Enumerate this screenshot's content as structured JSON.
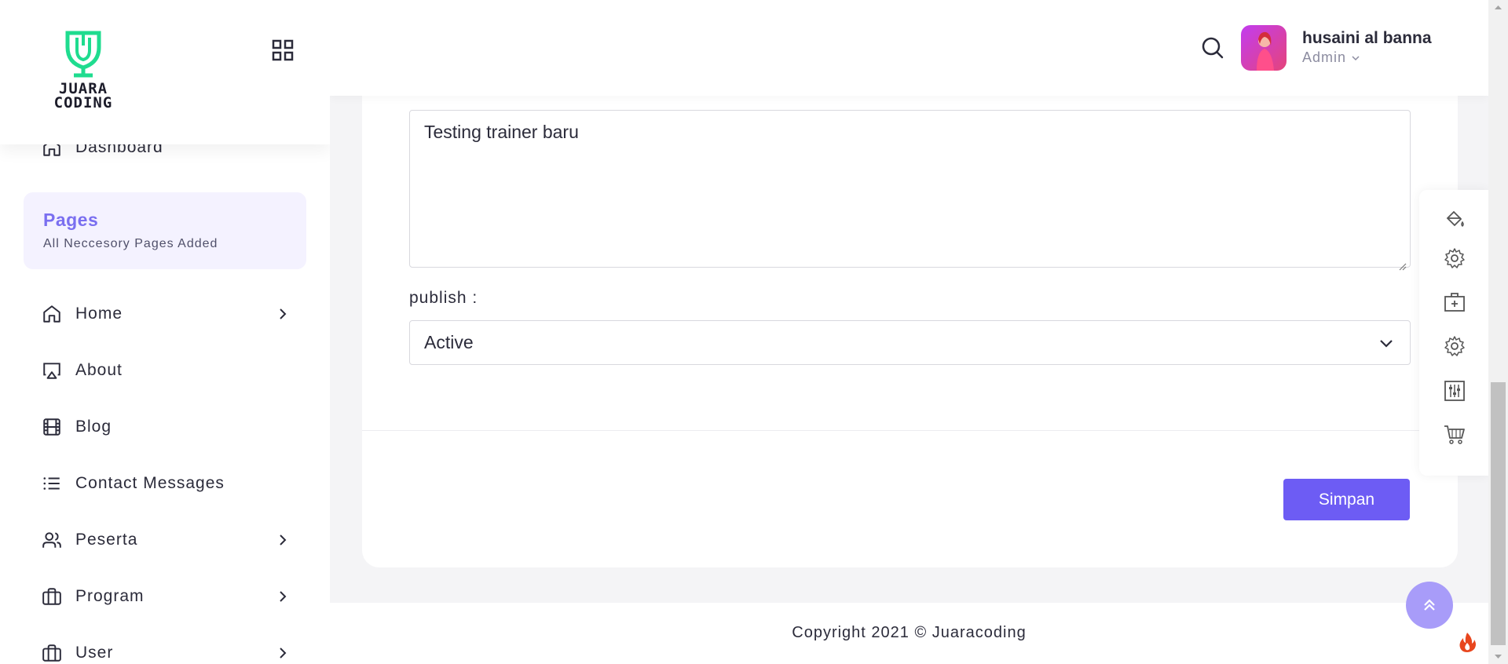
{
  "brand": {
    "logo_text_line1": "JUARA",
    "logo_text_line2": "CODING",
    "accent": "#1fdc8f"
  },
  "sidebar": {
    "dashboard": {
      "label": "Dashboard",
      "icon": "home-icon"
    },
    "pages_section": {
      "title": "Pages",
      "subtitle": "All Neccesory Pages Added"
    },
    "items": [
      {
        "label": "Home",
        "icon": "home-icon",
        "has_submenu": true
      },
      {
        "label": "About",
        "icon": "airplay-icon",
        "has_submenu": false
      },
      {
        "label": "Blog",
        "icon": "film-icon",
        "has_submenu": false
      },
      {
        "label": "Contact Messages",
        "icon": "list-icon",
        "has_submenu": false
      },
      {
        "label": "Peserta",
        "icon": "users-icon",
        "has_submenu": true
      },
      {
        "label": "Program",
        "icon": "briefcase-icon",
        "has_submenu": true
      },
      {
        "label": "User",
        "icon": "briefcase-icon",
        "has_submenu": true
      }
    ]
  },
  "header": {
    "user_name": "husaini al banna",
    "user_role": "Admin"
  },
  "form": {
    "description_value": "Testing trainer baru",
    "publish_label": "publish :",
    "publish_selected": "Active",
    "submit_label": "Simpan"
  },
  "tools": [
    "paint-bucket-icon",
    "gear-icon",
    "medical-box-icon",
    "gear-icon",
    "sliders-icon",
    "cart-icon"
  ],
  "footer": {
    "copyright": "Copyright 2021 © Juaracoding"
  },
  "colors": {
    "primary": "#6d5cf4",
    "pages_title": "#7a6ff0",
    "scroll_top_bg": "#a89cf9"
  }
}
